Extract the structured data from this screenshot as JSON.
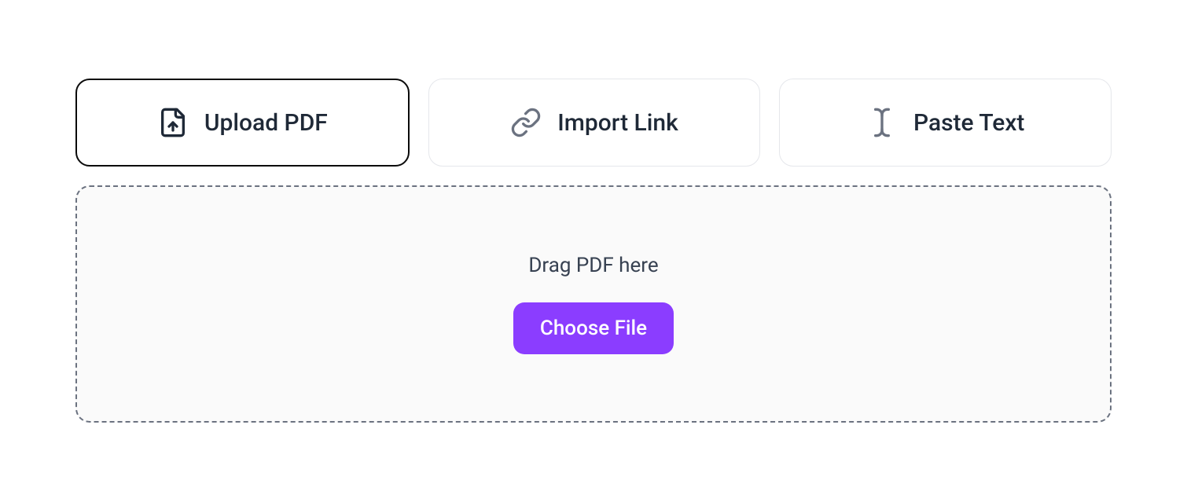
{
  "tabs": {
    "upload_pdf": {
      "label": "Upload PDF"
    },
    "import_link": {
      "label": "Import Link"
    },
    "paste_text": {
      "label": "Paste Text"
    }
  },
  "dropzone": {
    "prompt": "Drag PDF here",
    "button_label": "Choose File"
  },
  "colors": {
    "accent": "#8b3dff"
  }
}
